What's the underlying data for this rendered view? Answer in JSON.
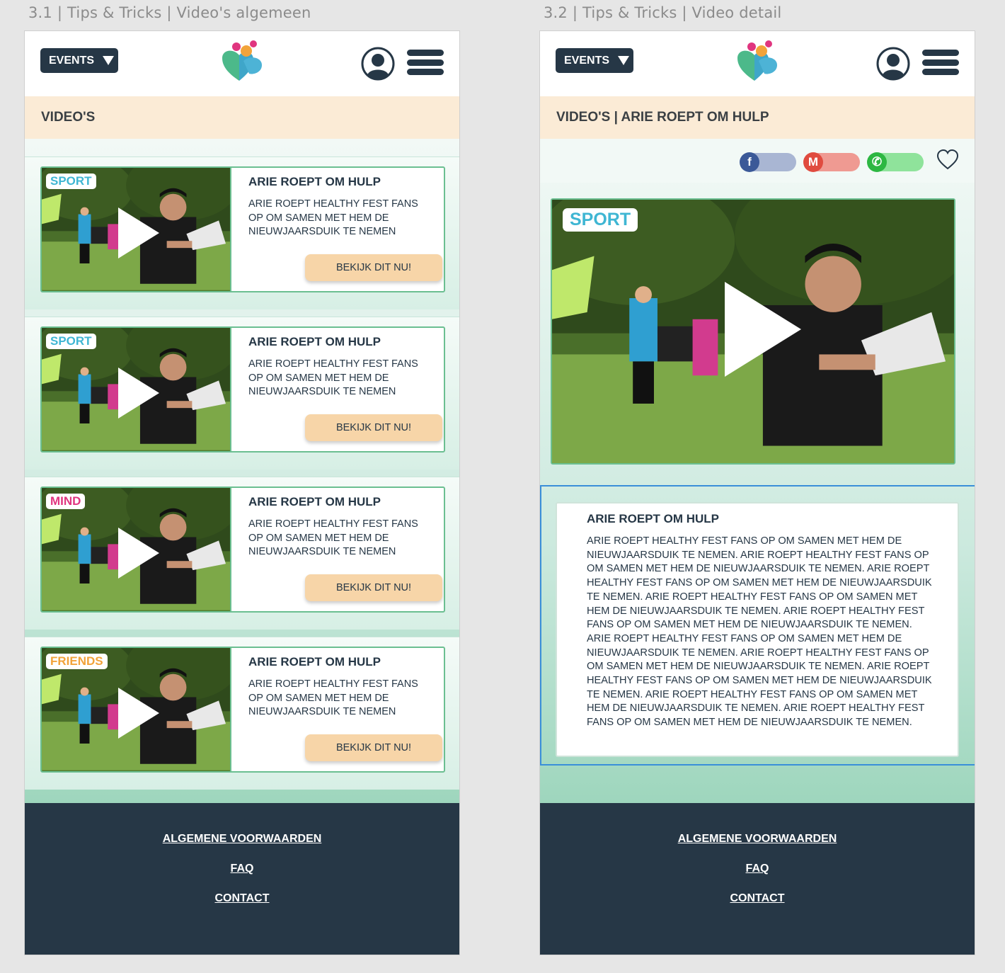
{
  "artboards": [
    {
      "label": "3.1 | Tips & Tricks | Video's algemeen"
    },
    {
      "label": "3.2 | Tips & Tricks | Video detail"
    }
  ],
  "header": {
    "events_label": "EVENTS",
    "logo_icon": "healthy-fest-heart-logo",
    "user_icon": "user-icon",
    "menu_icon": "hamburger-menu-icon"
  },
  "list_page": {
    "title": "VIDEO'S",
    "cards": [
      {
        "tag": "SPORT",
        "tag_color": "#3fb6d3",
        "title": "ARIE ROEPT OM HULP",
        "text": "ARIE ROEPT HEALTHY FEST FANS OP OM SAMEN MET HEM DE NIEUWJAARSDUIK TE NEMEN",
        "button": "BEKIJK DIT NU!"
      },
      {
        "tag": "SPORT",
        "tag_color": "#3fb6d3",
        "title": "ARIE ROEPT OM HULP",
        "text": "ARIE ROEPT HEALTHY FEST FANS OP OM SAMEN MET HEM DE NIEUWJAARSDUIK TE NEMEN",
        "button": "BEKIJK DIT NU!"
      },
      {
        "tag": "MIND",
        "tag_color": "#e0357f",
        "title": "ARIE ROEPT OM HULP",
        "text": "ARIE ROEPT HEALTHY FEST FANS OP OM SAMEN MET HEM DE NIEUWJAARSDUIK TE NEMEN",
        "button": "BEKIJK DIT NU!"
      },
      {
        "tag": "FRIENDS",
        "tag_color": "#f2a33a",
        "title": "ARIE ROEPT OM HULP",
        "text": "ARIE ROEPT HEALTHY FEST FANS OP OM SAMEN MET HEM DE NIEUWJAARSDUIK TE NEMEN",
        "button": "BEKIJK DIT NU!"
      }
    ]
  },
  "detail_page": {
    "title": "VIDEO'S | ARIE ROEPT OM HULP",
    "share": [
      {
        "icon": "facebook-icon",
        "glyph": "f",
        "color": "#3b5998",
        "bar": "#a9b6d3"
      },
      {
        "icon": "gmail-icon",
        "glyph": "M",
        "color": "#e04b3f",
        "bar": "#ef9a92"
      },
      {
        "icon": "whatsapp-icon",
        "glyph": "✆",
        "color": "#2db742",
        "bar": "#8fe39b"
      }
    ],
    "tag": "SPORT",
    "desc_title": "ARIE ROEPT OM HULP",
    "desc_text": "ARIE ROEPT HEALTHY FEST FANS OP OM SAMEN MET HEM DE NIEUWJAARSDUIK TE NEMEN. ARIE ROEPT HEALTHY FEST FANS OP OM SAMEN MET HEM DE NIEUWJAARSDUIK TE NEMEN. ARIE ROEPT HEALTHY FEST FANS OP OM SAMEN MET HEM DE NIEUWJAARSDUIK TE NEMEN. ARIE ROEPT HEALTHY FEST FANS OP OM SAMEN MET HEM DE NIEUWJAARSDUIK TE NEMEN. ARIE ROEPT HEALTHY FEST FANS OP OM SAMEN MET HEM DE NIEUWJAARSDUIK TE NEMEN. ARIE ROEPT HEALTHY FEST FANS OP OM SAMEN MET HEM DE NIEUWJAARSDUIK TE NEMEN. ARIE ROEPT HEALTHY FEST FANS OP OM SAMEN MET HEM DE NIEUWJAARSDUIK TE NEMEN. ARIE ROEPT HEALTHY FEST FANS OP OM SAMEN MET HEM DE NIEUWJAARSDUIK TE NEMEN. ARIE ROEPT HEALTHY FEST FANS OP OM SAMEN MET HEM DE NIEUWJAARSDUIK TE NEMEN. ARIE ROEPT HEALTHY FEST FANS OP OM SAMEN MET HEM DE NIEUWJAARSDUIK TE NEMEN."
  },
  "footer": {
    "links": [
      "ALGEMENE VOORWAARDEN",
      "FAQ",
      "CONTACT"
    ]
  },
  "colors": {
    "navy": "#263746",
    "green_border": "#6bbf91",
    "peach": "#fbebd6",
    "button": "#f7d5a8"
  }
}
